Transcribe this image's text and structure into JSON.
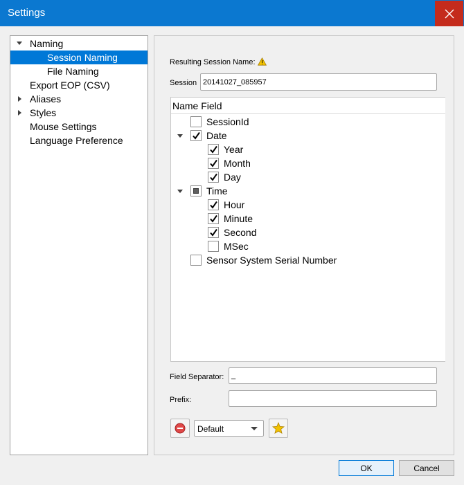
{
  "window": {
    "title": "Settings"
  },
  "nav": {
    "items": [
      {
        "label": "Naming",
        "expander": "expanded"
      },
      {
        "label": "Session Naming",
        "selected": true
      },
      {
        "label": "File Naming"
      },
      {
        "label": "Export EOP (CSV)"
      },
      {
        "label": "Aliases",
        "expander": "collapsed"
      },
      {
        "label": "Styles",
        "expander": "collapsed"
      },
      {
        "label": "Mouse Settings"
      },
      {
        "label": "Language Preference"
      }
    ]
  },
  "session_naming": {
    "resulting_label": "Resulting Session Name:",
    "warning_icon": "warning-icon",
    "session_label": "Session",
    "session_value": "20141027_085957",
    "tree_header": "Name Field",
    "fields": [
      {
        "label": "SessionId",
        "state": "unchecked",
        "level": 0
      },
      {
        "label": "Date",
        "state": "checked",
        "level": 0,
        "expander": "expanded"
      },
      {
        "label": "Year",
        "state": "checked",
        "level": 1
      },
      {
        "label": "Month",
        "state": "checked",
        "level": 1
      },
      {
        "label": "Day",
        "state": "checked",
        "level": 1
      },
      {
        "label": "Time",
        "state": "partial",
        "level": 0,
        "expander": "expanded"
      },
      {
        "label": "Hour",
        "state": "checked",
        "level": 1
      },
      {
        "label": "Minute",
        "state": "checked",
        "level": 1
      },
      {
        "label": "Second",
        "state": "checked",
        "level": 1
      },
      {
        "label": "MSec",
        "state": "unchecked",
        "level": 1
      },
      {
        "label": "Sensor System Serial Number",
        "state": "unchecked",
        "level": 0
      }
    ],
    "separator_label": "Field Separator:",
    "separator_value": "_",
    "prefix_label": "Prefix:",
    "prefix_value": "",
    "preset_value": "Default",
    "remove_icon": "remove-preset-icon",
    "save_icon": "star-icon"
  },
  "buttons": {
    "ok": "OK",
    "cancel": "Cancel"
  },
  "colors": {
    "title_bar": "#0b78d0",
    "close": "#c42b1c",
    "selection": "#0078d7"
  }
}
